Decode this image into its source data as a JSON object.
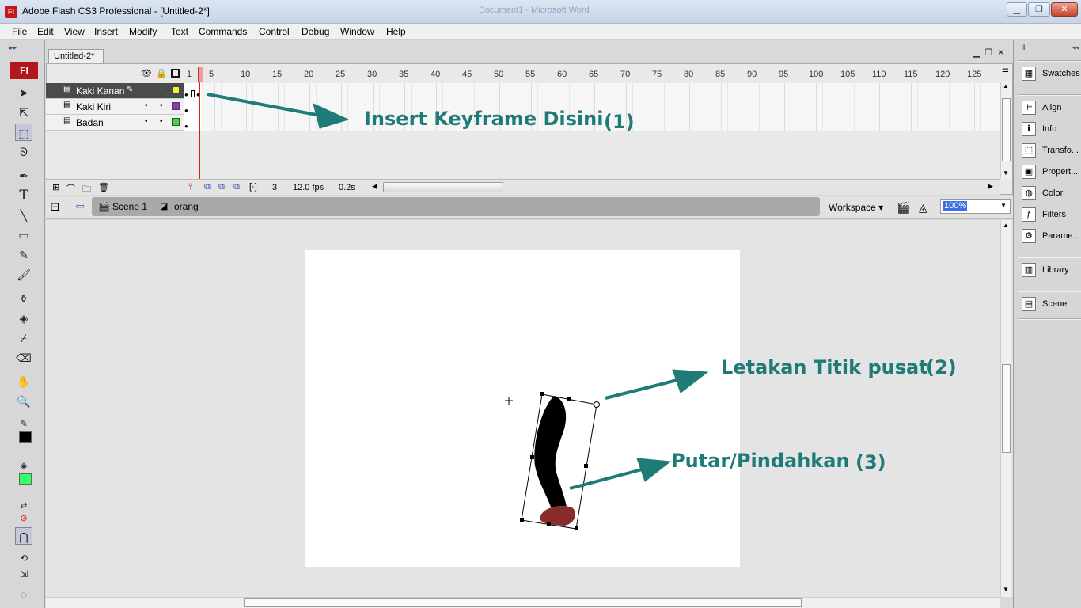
{
  "window": {
    "title": "Adobe Flash CS3 Professional - [Untitled-2*]",
    "app_icon": "Fl",
    "background_window_title": "Document1 - Microsoft Word"
  },
  "menu": [
    "File",
    "Edit",
    "View",
    "Insert",
    "Modify",
    "Text",
    "Commands",
    "Control",
    "Debug",
    "Window",
    "Help"
  ],
  "tools": {
    "logo": "Fl",
    "text_tool": "T",
    "items": [
      "selection-tool",
      "subselection-tool",
      "free-transform-tool",
      "lasso-tool",
      "pen-tool",
      "text-tool",
      "line-tool",
      "rectangle-tool",
      "pencil-tool",
      "brush-tool",
      "ink-bottle-tool",
      "paint-bucket-tool",
      "eyedropper-tool",
      "eraser-tool",
      "hand-tool",
      "zoom-tool"
    ],
    "stroke_color": "#000000",
    "fill_color": "#33ff66"
  },
  "document": {
    "tab": "Untitled-2*"
  },
  "timeline": {
    "ruler": [
      "1",
      "5",
      "10",
      "15",
      "20",
      "25",
      "30",
      "35",
      "40",
      "45",
      "50",
      "55",
      "60",
      "65",
      "70",
      "75",
      "80",
      "85",
      "90",
      "95",
      "100",
      "105",
      "110",
      "115",
      "120",
      "125"
    ],
    "layers": [
      {
        "name": "Kaki Kanan",
        "color": "#f2f23a",
        "active": true
      },
      {
        "name": "Kaki Kiri",
        "color": "#9b30c8",
        "active": false
      },
      {
        "name": "Badan",
        "color": "#33dd33",
        "active": false
      }
    ],
    "current_frame": "3",
    "frame_rate": "12.0 fps",
    "elapsed": "0.2s"
  },
  "editbar": {
    "scene": "Scene 1",
    "symbol": "orang",
    "workspace": "Workspace",
    "zoom": "100%"
  },
  "annotations": {
    "a1": "Insert Keyframe Disini",
    "a1_num": "(1)",
    "a2": "Letakan Titik pusat",
    "a2_num": "(2)",
    "a3": "Putar/Pindahkan",
    "a3_num": "(3)",
    "color": "#1e7b78"
  },
  "right_panels": {
    "group1": [
      "Swatches"
    ],
    "group2": [
      "Align",
      "Info",
      "Transfo...",
      "Propert...",
      "Color",
      "Filters",
      "Parame..."
    ],
    "group3": [
      "Library"
    ],
    "group4": [
      "Scene"
    ]
  }
}
